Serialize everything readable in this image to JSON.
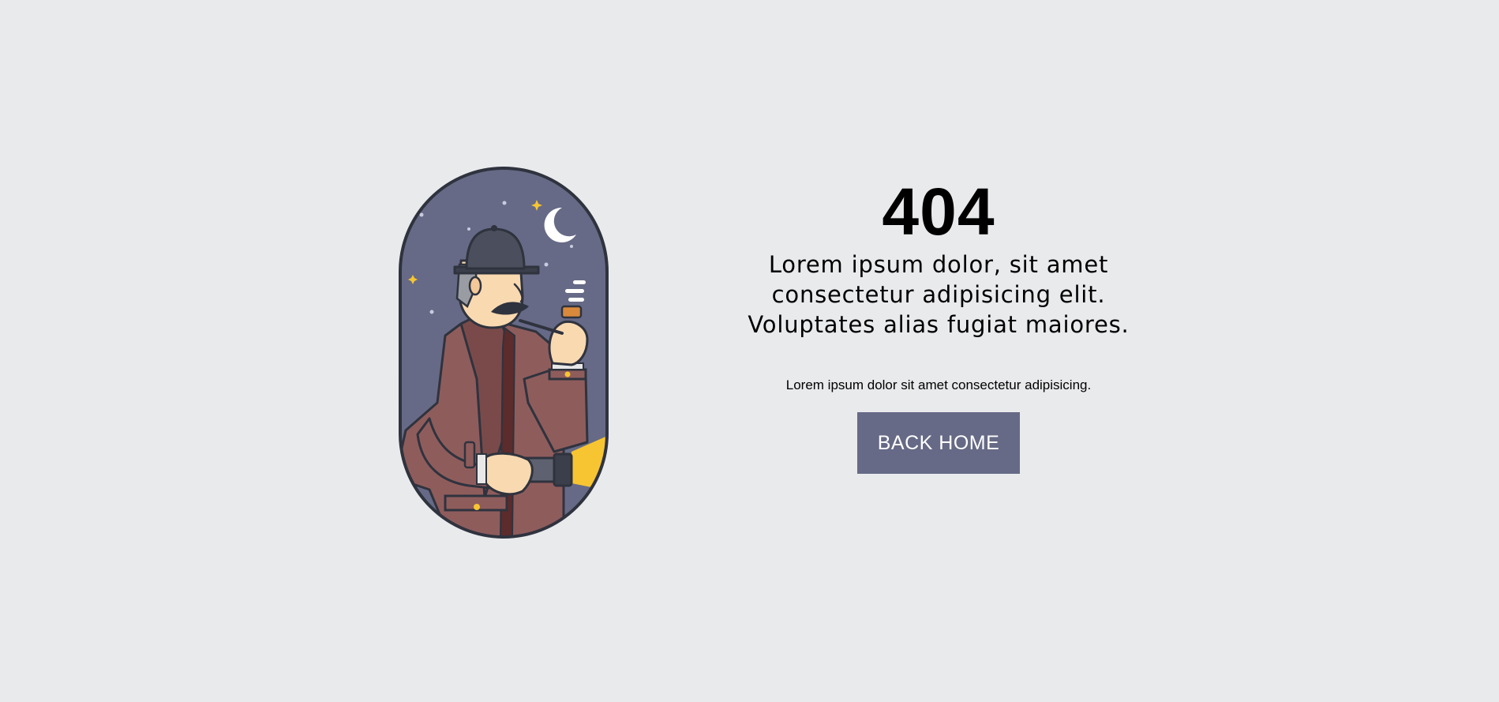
{
  "error": {
    "code": "404",
    "headline": "Lorem ipsum dolor, sit amet consectetur adipisicing elit. Voluptates alias fugiat maiores.",
    "subtext": "Lorem ipsum dolor sit amet consectetur adipisicing."
  },
  "actions": {
    "back_home_label": "BACK HOME"
  },
  "colors": {
    "page_background": "#e9eaec",
    "button_background": "#666a86",
    "button_text": "#ffffff",
    "illustration_night_sky": "#666a86",
    "illustration_coat": "#8f5c5c",
    "illustration_light": "#f7c531"
  },
  "illustration": {
    "icon": "detective-with-flashlight-illustration"
  }
}
